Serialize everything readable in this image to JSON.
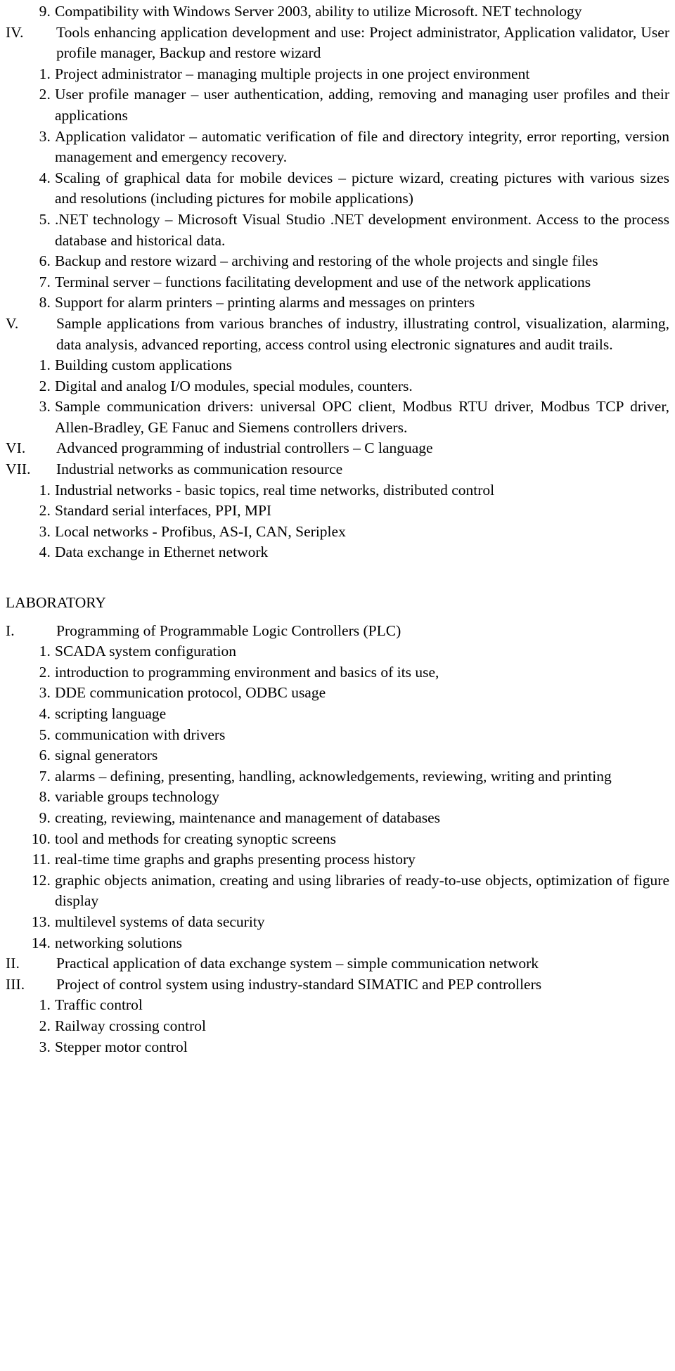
{
  "document": {
    "lecture_section": {
      "items": [
        {
          "level": "number",
          "marker": "9.",
          "text": "Compatibility with Windows Server 2003, ability to utilize Microsoft. NET technology"
        },
        {
          "level": "roman",
          "marker": "IV.",
          "text": "Tools enhancing application development and use: Project administrator, Application validator, User profile manager, Backup and restore wizard"
        },
        {
          "level": "number",
          "marker": "1.",
          "text": "Project administrator – managing multiple projects in one project environment"
        },
        {
          "level": "number",
          "marker": "2.",
          "text": "User profile manager – user authentication, adding, removing and managing user profiles and their applications"
        },
        {
          "level": "number",
          "marker": "3.",
          "text": "Application validator – automatic verification of file and directory integrity, error reporting, version management and emergency recovery."
        },
        {
          "level": "number",
          "marker": "4.",
          "text": "Scaling of graphical data for mobile devices – picture wizard, creating pictures with various sizes and resolutions (including pictures for mobile applications)"
        },
        {
          "level": "number",
          "marker": "5.",
          "text": ".NET technology – Microsoft Visual Studio .NET development environment. Access to the process database and historical data."
        },
        {
          "level": "number",
          "marker": "6.",
          "text": "Backup and restore wizard – archiving and restoring of the whole projects and single files"
        },
        {
          "level": "number",
          "marker": "7.",
          "text": "Terminal server – functions facilitating development and use of the network applications"
        },
        {
          "level": "number",
          "marker": "8.",
          "text": "Support for alarm printers – printing alarms and messages on printers"
        },
        {
          "level": "roman",
          "marker": "V.",
          "text": "Sample applications from various branches of industry, illustrating control, visualization, alarming, data analysis, advanced reporting, access control using electronic signatures and audit trails."
        },
        {
          "level": "number",
          "marker": "1.",
          "text": "Building custom applications"
        },
        {
          "level": "number",
          "marker": "2.",
          "text": "Digital and analog I/O modules, special modules, counters."
        },
        {
          "level": "number",
          "marker": "3.",
          "text": "Sample communication drivers: universal OPC client, Modbus RTU driver, Modbus TCP driver, Allen-Bradley, GE Fanuc and Siemens controllers drivers."
        },
        {
          "level": "roman",
          "marker": "VI.",
          "text": "Advanced programming of industrial controllers – C language"
        },
        {
          "level": "roman",
          "marker": "VII.",
          "text": "Industrial networks as communication resource"
        },
        {
          "level": "number",
          "marker": "1.",
          "text": "Industrial networks - basic topics, real time networks, distributed control"
        },
        {
          "level": "number",
          "marker": "2.",
          "text": "Standard serial interfaces, PPI, MPI"
        },
        {
          "level": "number",
          "marker": "3.",
          "text": "Local networks - Profibus, AS-I, CAN, Seriplex"
        },
        {
          "level": "number",
          "marker": "4.",
          "text": "Data exchange in Ethernet network"
        }
      ]
    },
    "laboratory_section": {
      "heading": "LABORATORY",
      "items": [
        {
          "level": "roman",
          "marker": "I.",
          "text": "Programming of Programmable Logic Controllers (PLC)"
        },
        {
          "level": "number",
          "marker": "1.",
          "text": "SCADA system configuration"
        },
        {
          "level": "number",
          "marker": "2.",
          "text": "introduction to programming environment and basics of its use,"
        },
        {
          "level": "number",
          "marker": "3.",
          "text": "DDE communication protocol, ODBC usage"
        },
        {
          "level": "number",
          "marker": "4.",
          "text": "scripting language"
        },
        {
          "level": "number",
          "marker": "5.",
          "text": "communication with drivers"
        },
        {
          "level": "number",
          "marker": "6.",
          "text": "signal generators"
        },
        {
          "level": "number",
          "marker": "7.",
          "text": "alarms – defining, presenting, handling, acknowledgements, reviewing, writing and printing"
        },
        {
          "level": "number",
          "marker": "8.",
          "text": "variable groups technology"
        },
        {
          "level": "number",
          "marker": "9.",
          "text": "creating, reviewing, maintenance and management of databases"
        },
        {
          "level": "number",
          "marker": "10.",
          "text": "tool and methods for creating synoptic screens"
        },
        {
          "level": "number",
          "marker": "11.",
          "text": "real-time time graphs and graphs presenting process history"
        },
        {
          "level": "number",
          "marker": "12.",
          "text": "graphic objects animation, creating and using libraries of ready-to-use objects, optimization of figure display"
        },
        {
          "level": "number",
          "marker": "13.",
          "text": "multilevel systems of data security"
        },
        {
          "level": "number",
          "marker": "14.",
          "text": "networking solutions"
        },
        {
          "level": "roman",
          "marker": "II.",
          "text": "Practical application of data exchange system – simple communication network"
        },
        {
          "level": "roman",
          "marker": "III.",
          "text": "Project of control system using industry-standard SIMATIC and PEP controllers"
        },
        {
          "level": "number",
          "marker": "1.",
          "text": "Traffic control"
        },
        {
          "level": "number",
          "marker": "2.",
          "text": "Railway crossing control"
        },
        {
          "level": "number",
          "marker": "3.",
          "text": "Stepper motor control"
        }
      ]
    }
  }
}
